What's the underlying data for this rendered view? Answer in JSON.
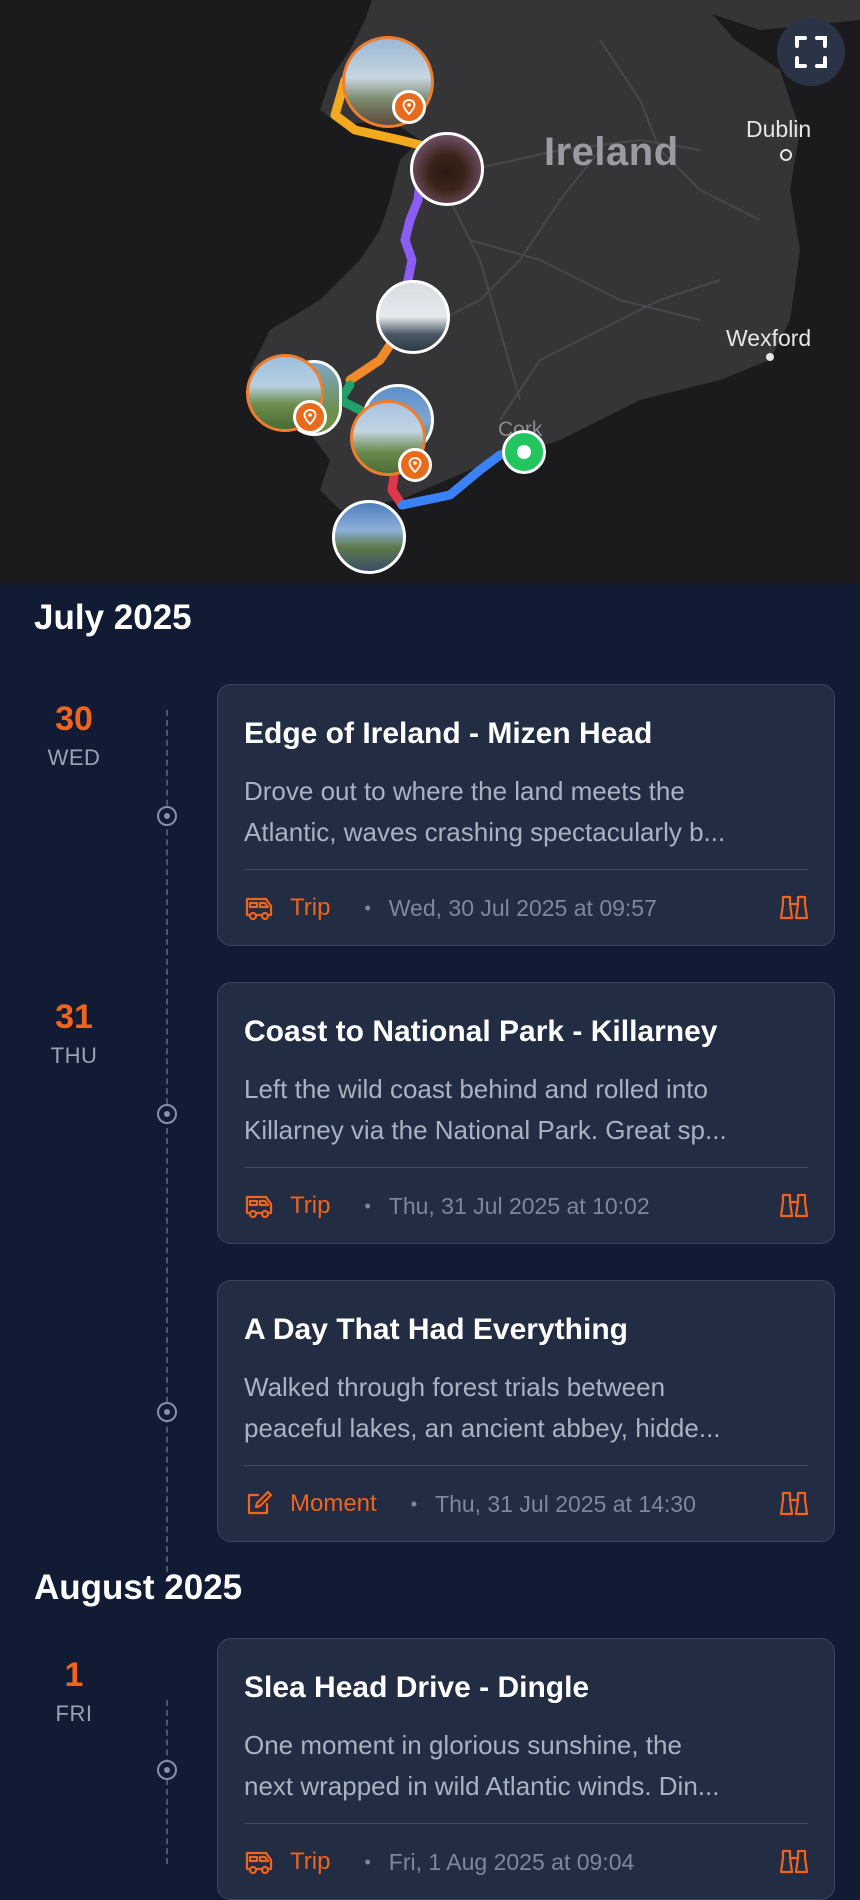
{
  "map": {
    "country_label": "Ireland",
    "city_labels": [
      "Dublin",
      "Wexford"
    ],
    "town_labels": [
      "Cork"
    ],
    "fullscreen_icon": "expand-icon",
    "route_colors": [
      "#f2a91e",
      "#8b5cf6",
      "#f08a28",
      "#22a06b",
      "#e0364a",
      "#3b82f6"
    ],
    "start_color": "#22c55e"
  },
  "timeline": {
    "months": [
      "July 2025",
      "August 2025"
    ],
    "days": [
      {
        "num": "30",
        "dow": "WED"
      },
      {
        "num": "31",
        "dow": "THU"
      },
      {
        "num": "1",
        "dow": "FRI"
      }
    ],
    "entries": [
      {
        "title": "Edge of Ireland - Mizen Head",
        "desc_line1": "Drove out to where the land meets the",
        "desc_line2": "Atlantic, waves crashing spectacularly b...",
        "kind": "Trip",
        "kind_icon": "camper-van-icon",
        "time": "Wed, 30 Jul 2025 at 09:57"
      },
      {
        "title": "Coast to National Park - Killarney",
        "desc_line1": "Left the wild coast behind and rolled into",
        "desc_line2": "Killarney via the National Park. Great sp...",
        "kind": "Trip",
        "kind_icon": "camper-van-icon",
        "time": "Thu, 31 Jul 2025 at 10:02"
      },
      {
        "title": "A Day That Had Everything",
        "desc_line1": "Walked through forest trials between",
        "desc_line2": "peaceful lakes, an ancient abbey, hidde...",
        "kind": "Moment",
        "kind_icon": "edit-note-icon",
        "time": "Thu, 31 Jul 2025 at 14:30"
      },
      {
        "title": "Slea Head Drive - Dingle",
        "desc_line1": "One moment in glorious sunshine, the",
        "desc_line2": "next wrapped in wild Atlantic winds. Din...",
        "kind": "Trip",
        "kind_icon": "camper-van-icon",
        "time": "Fri, 1 Aug 2025 at 09:04"
      }
    ]
  },
  "colors": {
    "accent": "#f0641e",
    "background": "#111b33",
    "card": "#222c42"
  }
}
